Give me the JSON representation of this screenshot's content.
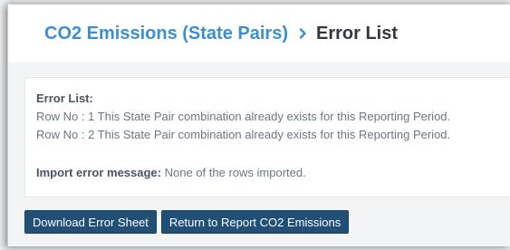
{
  "breadcrumb": {
    "parent": "CO2 Emissions (State Pairs)",
    "separator_icon": "chevron-right-icon",
    "current": "Error List"
  },
  "errors": {
    "heading": "Error List:",
    "rows": [
      "Row No : 1 This State Pair combination already exists for this Reporting Period.",
      "Row No : 2 This State Pair combination already exists for this Reporting Period."
    ],
    "import_label": "Import error message:",
    "import_message": "None of the rows imported."
  },
  "actions": {
    "download_label": "Download Error Sheet",
    "return_label": "Return to Report CO2 Emissions"
  },
  "colors": {
    "link": "#3a8fd1",
    "button": "#214f75",
    "muted_text": "#6b7785"
  }
}
